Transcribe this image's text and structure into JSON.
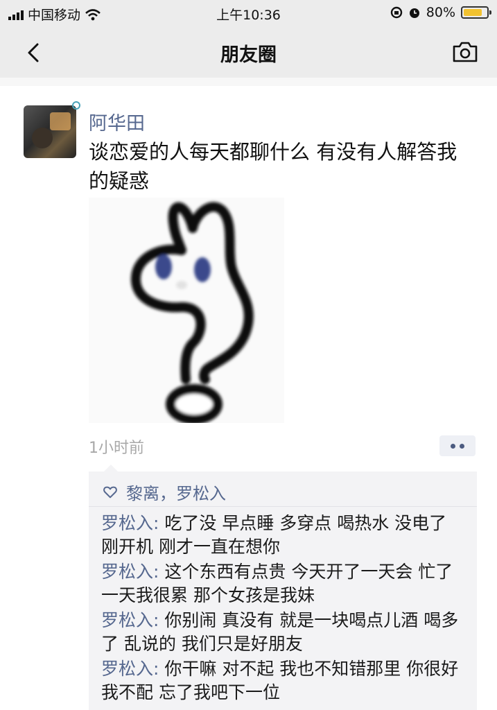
{
  "status_bar": {
    "carrier": "中国移动",
    "time": "上午10:36",
    "battery": "80%",
    "battery_level": 0.8
  },
  "nav": {
    "title": "朋友圈",
    "back_icon": "chevron-left-icon",
    "camera_icon": "camera-icon"
  },
  "post": {
    "author": "阿华田",
    "text": "谈恋爱的人每天都聊什么 有没有人解答我的疑惑",
    "time": "1小时前",
    "likes": "黎离，罗松入",
    "comments": [
      {
        "author": "罗松入",
        "sep": ": ",
        "text": "吃了没 早点睡 多穿点 喝热水 没电了 刚开机 刚才一直在想你"
      },
      {
        "author": "罗松入",
        "sep": ": ",
        "text": "这个东西有点贵 今天开了一天会 忙了一天我很累 那个女孩是我妹"
      },
      {
        "author": "罗松入",
        "sep": ": ",
        "text": "你别闹  真没有 就是一块喝点儿酒 喝多了 乱说的 我们只是好朋友"
      },
      {
        "author": "罗松入",
        "sep": ": ",
        "text": "你干嘛 对不起 我也不知错那里 你很好 我不配 忘了我吧下一位"
      }
    ]
  },
  "colors": {
    "nickname": "#56688f",
    "bar_bg": "#ececec",
    "comment_bg": "#f3f3f5"
  }
}
